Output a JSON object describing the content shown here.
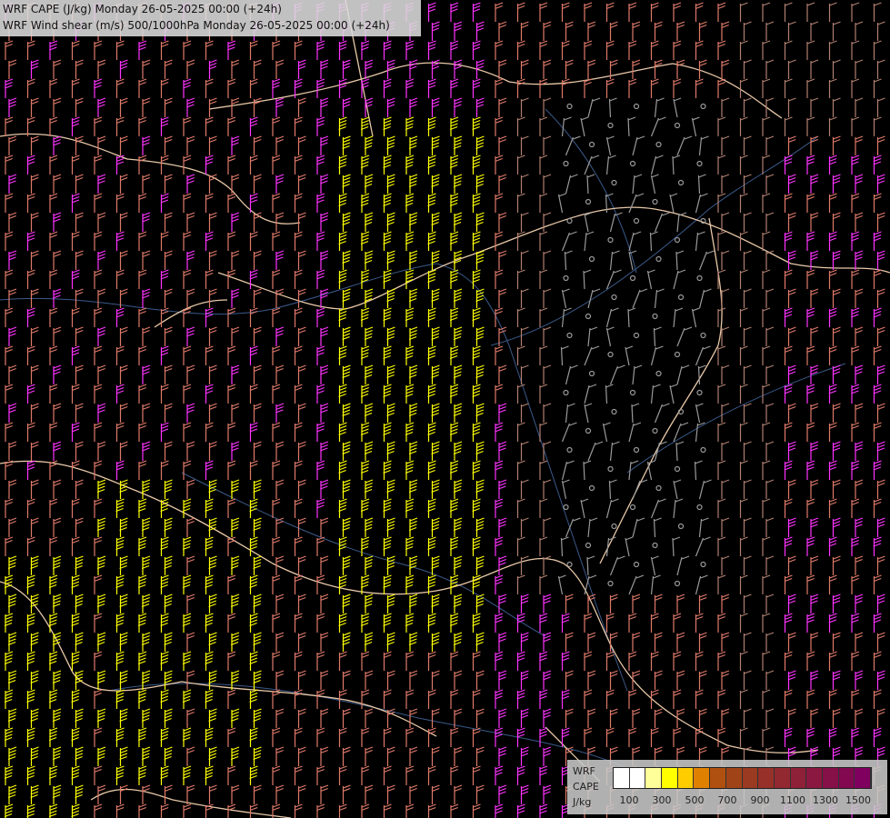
{
  "titles": {
    "line1": "WRF CAPE (J/kg) Monday 26-05-2025 00:00 (+24h)",
    "line2": "WRF Wind shear (m/s) 500/1000hPa Monday 26-05-2025 00:00 (+24h)"
  },
  "legend": {
    "label_line1": "WRF",
    "label_line2": "CAPE",
    "label_line3": "J/kg",
    "ticks": [
      "100",
      "300",
      "500",
      "700",
      "900",
      "1100",
      "1300",
      "1500"
    ],
    "colors": [
      "#ffffff",
      "#ffffff",
      "#ffff99",
      "#ffff00",
      "#ffcc00",
      "#e08000",
      "#b05010",
      "#a04418",
      "#9a3a20",
      "#963028",
      "#922830",
      "#8e2038",
      "#8a1840",
      "#861048",
      "#820850",
      "#800060"
    ]
  },
  "map": {
    "background": "#000000",
    "border_color": "#e8c8a8",
    "river_color": "#3a5a8a",
    "barb_colors": {
      "calm": "#9a9a9a",
      "light": "#b08070",
      "moderate": "#e07a6a",
      "strong": "#ff33ff",
      "very_strong": "#ffff00"
    }
  }
}
